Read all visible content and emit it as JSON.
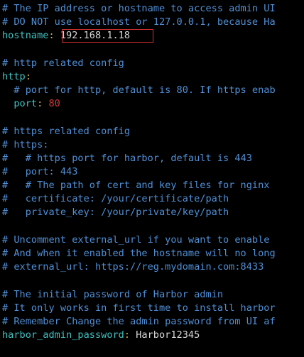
{
  "config": {
    "hostname_comment_1": "# The IP address or hostname to access admin UI",
    "hostname_comment_2": "# DO NOT use localhost or 127.0.0.1, because Ha",
    "hostname_key": "hostname",
    "hostname_value": "192.168.1.18",
    "http_comment": "# http related config",
    "http_key": "http",
    "http_port_comment": "  # port for http, default is 80. If https enab",
    "http_port_key": "  port",
    "http_port_value": "80",
    "https_comment": "# https related config",
    "https_line": "# https:",
    "https_port_comment": "#   # https port for harbor, default is 443",
    "https_port_line": "#   port: 443",
    "cert_path_comment": "#   # The path of cert and key files for nginx",
    "certificate_line": "#   certificate: /your/certificate/path",
    "private_key_line": "#   private_key: /your/private/key/path",
    "external_url_comment_1": "# Uncomment external_url if you want to enable",
    "external_url_comment_2": "# And when it enabled the hostname will no long",
    "external_url_line": "# external_url: https://reg.mydomain.com:8433",
    "admin_comment_1": "# The initial password of Harbor admin",
    "admin_comment_2": "# It only works in first time to install harbor",
    "admin_comment_3": "# Remember Change the admin password from UI af",
    "admin_password_key": "harbor_admin_password",
    "admin_password_value": "Harbor12345"
  },
  "colors": {
    "background": "#000000",
    "comment": "#4f8fd6",
    "key": "#40c0c0",
    "colon": "#c8b040",
    "value": "#d8d8d8",
    "number": "#d03a3a",
    "highlight_border": "#d03030"
  }
}
